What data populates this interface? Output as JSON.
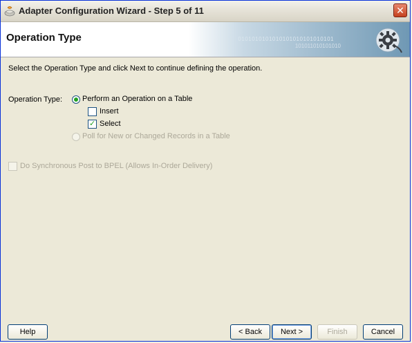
{
  "window": {
    "title": "Adapter Configuration Wizard - Step 5 of 11",
    "close_symbol": "✕"
  },
  "header": {
    "title": "Operation Type",
    "binary_text_1": "0101010101010101010101010101",
    "binary_text_2": "101011010101010"
  },
  "instruction": "Select the Operation Type and click Next to continue defining the operation.",
  "operation": {
    "label": "Operation Type:",
    "perform_option": "Perform an Operation on a Table",
    "insert_label": "Insert",
    "select_label": "Select",
    "poll_option": "Poll for New or Changed Records in a Table"
  },
  "synchronous_label": "Do Synchronous Post to BPEL (Allows In-Order Delivery)",
  "buttons": {
    "help": "Help",
    "back": "< Back",
    "next": "Next >",
    "finish": "Finish",
    "cancel": "Cancel"
  },
  "state": {
    "perform_selected": true,
    "insert_checked": false,
    "select_checked": true,
    "poll_enabled": false,
    "sync_enabled": false
  },
  "colors": {
    "title_bar": "#e6e3d8",
    "close": "#c4401d",
    "accent_check": "#21a121",
    "header_band": "#6f98b4"
  }
}
